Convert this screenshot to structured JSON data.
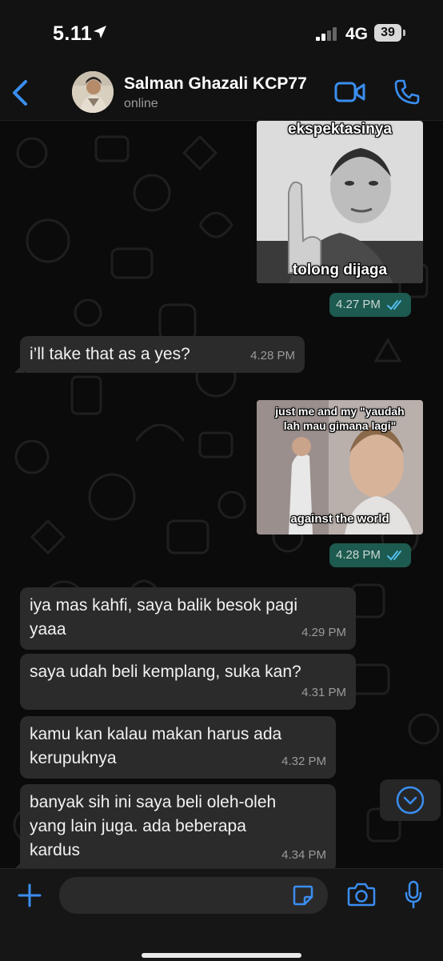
{
  "status_bar": {
    "time": "5.11",
    "network": "4G",
    "battery": "39"
  },
  "header": {
    "contact_name": "Salman Ghazali KCP77",
    "contact_status": "online"
  },
  "messages": [
    {
      "type": "image",
      "direction": "outgoing",
      "caption_top": "ekspektasinya",
      "caption_bottom": "tolong dijaga",
      "time": "4.27 PM",
      "read": true
    },
    {
      "type": "text",
      "direction": "incoming",
      "text": "i’ll take that as a yes?",
      "time": "4.28 PM"
    },
    {
      "type": "image",
      "direction": "outgoing",
      "caption_top_line1": "just me and my \"yaudah",
      "caption_top_line2": "lah mau gimana lagi\"",
      "caption_bottom": "against the world",
      "time": "4.28 PM",
      "read": true
    },
    {
      "type": "text",
      "direction": "incoming",
      "line1": "iya mas kahfi, saya balik besok pagi",
      "line2": "yaaa",
      "time": "4.29 PM"
    },
    {
      "type": "text",
      "direction": "incoming",
      "text": "saya udah beli kemplang, suka kan?",
      "time": "4.31 PM"
    },
    {
      "type": "text",
      "direction": "incoming",
      "line1": "kamu kan kalau makan harus ada",
      "line2": "kerupuknya",
      "time": "4.32 PM"
    },
    {
      "type": "text",
      "direction": "incoming",
      "line1": "banyak sih ini saya beli oleh-oleh",
      "line2": "yang lain juga. ada beberapa",
      "line3": "kardus",
      "time": "4.34 PM"
    }
  ],
  "input": {
    "placeholder": ""
  },
  "icons": [
    "location-arrow-icon",
    "signal-icon",
    "back-icon",
    "video-call-icon",
    "phone-icon",
    "read-ticks-icon",
    "chevron-down-icon",
    "plus-icon",
    "sticker-icon",
    "camera-icon",
    "mic-icon"
  ],
  "colors": {
    "accent": "#3a8ef0",
    "outgoing_time_bg": "#1d5a4f",
    "incoming_bubble": "#2b2b2b",
    "read_ticks": "#53bdeb",
    "background": "#0b0b0b"
  }
}
